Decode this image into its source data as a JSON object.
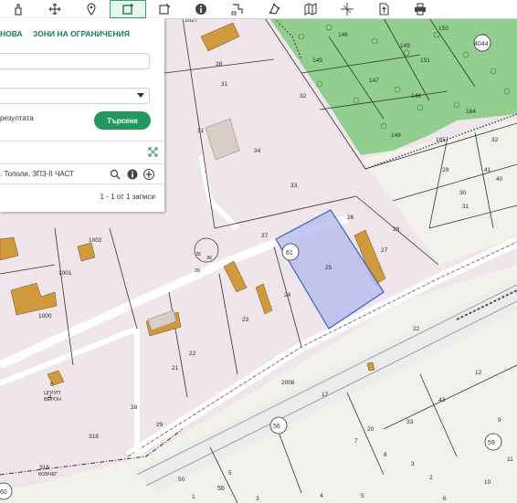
{
  "toolbar": {
    "tools": [
      {
        "name": "pan-icon"
      },
      {
        "name": "move-icon"
      },
      {
        "name": "pin-icon"
      },
      {
        "name": "select-rectangle-icon",
        "active": true
      },
      {
        "name": "select-edit-icon"
      },
      {
        "name": "info-icon"
      },
      {
        "name": "route-icon"
      },
      {
        "name": "polygon-icon"
      },
      {
        "name": "map-layers-icon"
      },
      {
        "name": "crosshair-icon"
      },
      {
        "name": "export-icon"
      },
      {
        "name": "print-icon"
      }
    ]
  },
  "panel": {
    "tab_1": "НОВА",
    "tab_2": "ЗОНИ НА ОГРАНИЧЕНИЯ",
    "results_label": "резултата",
    "search_button": "Търсене",
    "result_item": ". Тополи, ЗПЗ-II ЧАСТ",
    "pager": "1 - 1 от 1 записи"
  },
  "map": {
    "colors": {
      "residential": "#efe5ea",
      "forest": "#8fd08a",
      "plain": "#f3f1ec",
      "building": "#d09a3c",
      "selection": "#b8c0ef"
    },
    "parcel_labels": [
      "1027",
      "38",
      "31",
      "32",
      "31",
      "34",
      "33",
      "37",
      "26",
      "28",
      "27",
      "25",
      "24",
      "23",
      "22",
      "21",
      "146",
      "145",
      "147",
      "148",
      "149",
      "150",
      "151",
      "148",
      "184",
      "185",
      "32",
      "41",
      "40",
      "29",
      "30",
      "31",
      "1002",
      "1001",
      "1000",
      "35",
      "36",
      "39",
      "28",
      "29",
      "318",
      "316",
      "6",
      "4",
      "22",
      "17",
      "33",
      "43",
      "59",
      "56",
      "50",
      "20",
      "2008",
      "9",
      "3",
      "2",
      "5",
      "7",
      "8",
      "1",
      "3",
      "4",
      "5",
      "6",
      "10",
      "11",
      "12"
    ],
    "circle_labels": [
      "4044",
      "61",
      "56",
      "59",
      "60"
    ],
    "text_labels": {
      "ring_road": "2008",
      "note_a": "ЦГРУП ВЕРОН",
      "note_b": "КОВЧЕГ"
    }
  }
}
